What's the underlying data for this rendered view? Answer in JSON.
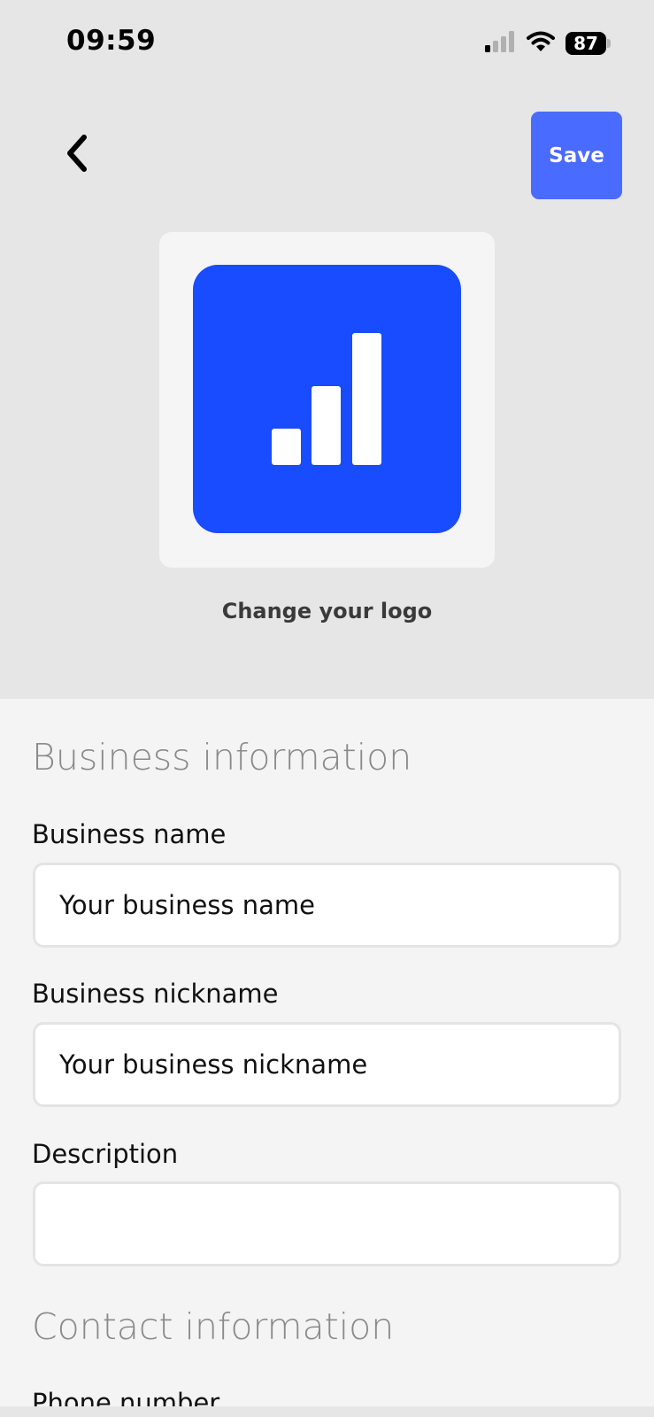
{
  "status_bar": {
    "time": "09:59",
    "battery_level": "87",
    "icons": [
      "cellular-signal-icon",
      "wifi-icon",
      "battery-icon"
    ]
  },
  "nav": {
    "back_icon": "chevron-left-icon",
    "save_label": "Save"
  },
  "logo": {
    "icon": "bar-chart-icon",
    "change_label": "Change your logo",
    "tile_color": "#1a4cff"
  },
  "business_information": {
    "title": "Business information",
    "fields": {
      "name": {
        "label": "Business name",
        "placeholder": "Your business name",
        "value": ""
      },
      "nickname": {
        "label": "Business nickname",
        "placeholder": "Your business nickname",
        "value": ""
      },
      "description": {
        "label": "Description",
        "placeholder": "",
        "value": ""
      }
    }
  },
  "contact_information": {
    "title": "Contact information",
    "phone_label": "Phone number"
  },
  "colors": {
    "accent": "#4a6bff",
    "header_bg": "#e6e6e6",
    "form_bg": "#f4f4f4"
  }
}
